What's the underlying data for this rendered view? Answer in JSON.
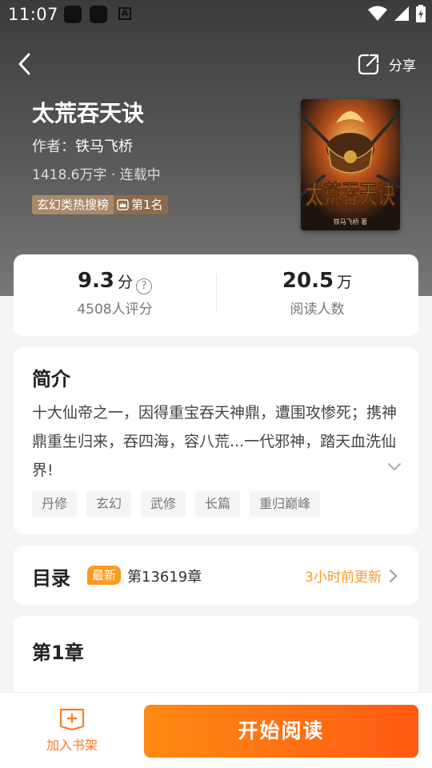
{
  "status_bar": {
    "time": "11:07",
    "a_glyph": "A",
    "icons": [
      "square-app-icon",
      "square-app-icon",
      "a-keyboard-icon",
      "wifi-icon",
      "signal-icon",
      "battery-charging-icon"
    ]
  },
  "nav": {
    "back_icon": "back-chevron-icon",
    "share_label": "分享",
    "share_icon": "share-icon"
  },
  "book": {
    "title": "太荒吞天诀",
    "author_label": "作者：",
    "author_name": "铁马飞桥",
    "meta": "1418.6万字 · 连载中",
    "rank_list": "玄幻类热搜榜",
    "rank_position": "第1名",
    "cover_title": "太荒吞天诀",
    "cover_author": "铁马飞桥 著"
  },
  "stats": {
    "score": "9.3",
    "score_unit": "分",
    "help_glyph": "?",
    "score_sub": "4508人评分",
    "readers": "20.5",
    "readers_unit": "万",
    "readers_sub": "阅读人数"
  },
  "intro": {
    "title": "简介",
    "text": "十大仙帝之一，因得重宝吞天神鼎，遭围攻惨死；携神鼎重生归来，吞四海，容八荒...一代邪神，踏天血洗仙界!",
    "tags": [
      "丹修",
      "玄幻",
      "武修",
      "长篇",
      "重归巅峰"
    ]
  },
  "toc": {
    "title": "目录",
    "badge": "最新",
    "latest_chapter": "第13619章",
    "update_time": "3小时前更新"
  },
  "chapter": {
    "title": "第1章"
  },
  "bottom": {
    "shelf_label": "加入书架",
    "read_label": "开始阅读"
  },
  "colors": {
    "accent": "#ff8a12",
    "accent_dark": "#ff5a12",
    "rank_bg": "#a88a6a",
    "rank_bg_dark": "#8d6b4c",
    "card_bg": "#ffffff",
    "page_bg": "#f5f5f5"
  }
}
